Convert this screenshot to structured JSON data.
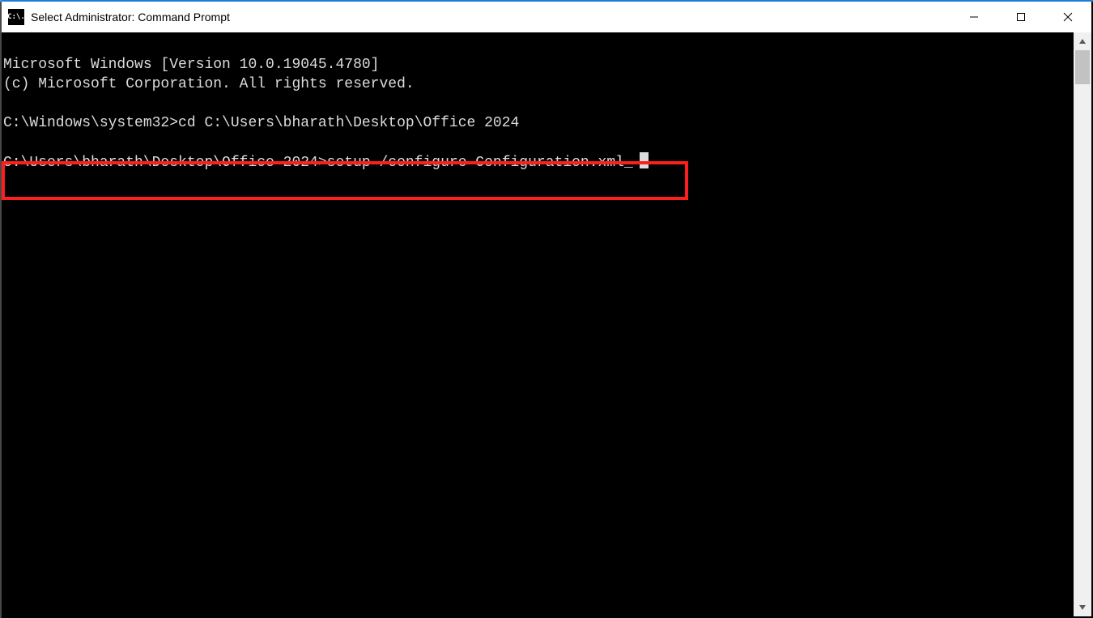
{
  "window": {
    "title": "Select Administrator: Command Prompt",
    "icon_label": "C:\\."
  },
  "console": {
    "line1": "Microsoft Windows [Version 10.0.19045.4780]",
    "line2": "(c) Microsoft Corporation. All rights reserved.",
    "blank1": "",
    "prompt1_path": "C:\\Windows\\system32>",
    "prompt1_cmd": "cd C:\\Users\\bharath\\Desktop\\Office 2024",
    "blank2": "",
    "prompt2_path": "C:\\Users\\bharath\\Desktop\\Office 2024>",
    "prompt2_cmd": "setup /configure Configuration.xml"
  },
  "highlight_color": "#ff1e1e"
}
